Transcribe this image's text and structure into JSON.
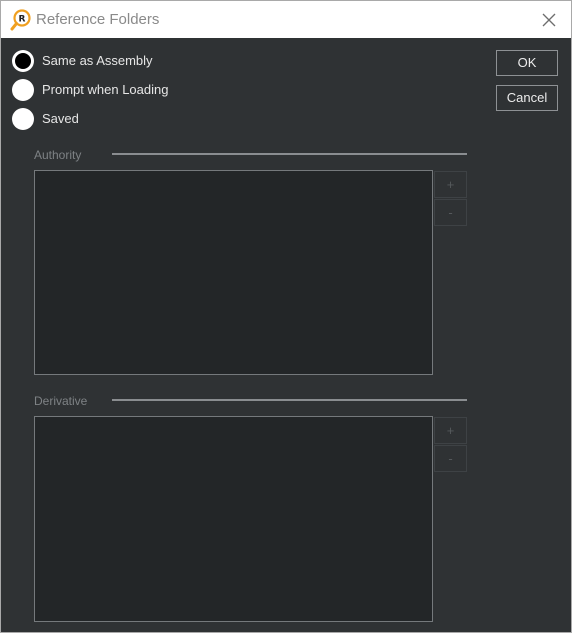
{
  "window": {
    "title": "Reference Folders",
    "icon": "app-logo-icon",
    "close_icon": "close-icon"
  },
  "options": {
    "items": [
      {
        "label": "Same as Assembly",
        "selected": true
      },
      {
        "label": "Prompt when Loading",
        "selected": false
      },
      {
        "label": "Saved",
        "selected": false
      }
    ]
  },
  "actions": {
    "ok_label": "OK",
    "cancel_label": "Cancel"
  },
  "authority": {
    "label": "Authority",
    "add_label": "+",
    "remove_label": "-"
  },
  "derivative": {
    "label": "Derivative",
    "add_label": "+",
    "remove_label": "-"
  },
  "colors": {
    "background": "#2f3234",
    "list_background": "#232628",
    "accent_icon": "#f0a020"
  }
}
